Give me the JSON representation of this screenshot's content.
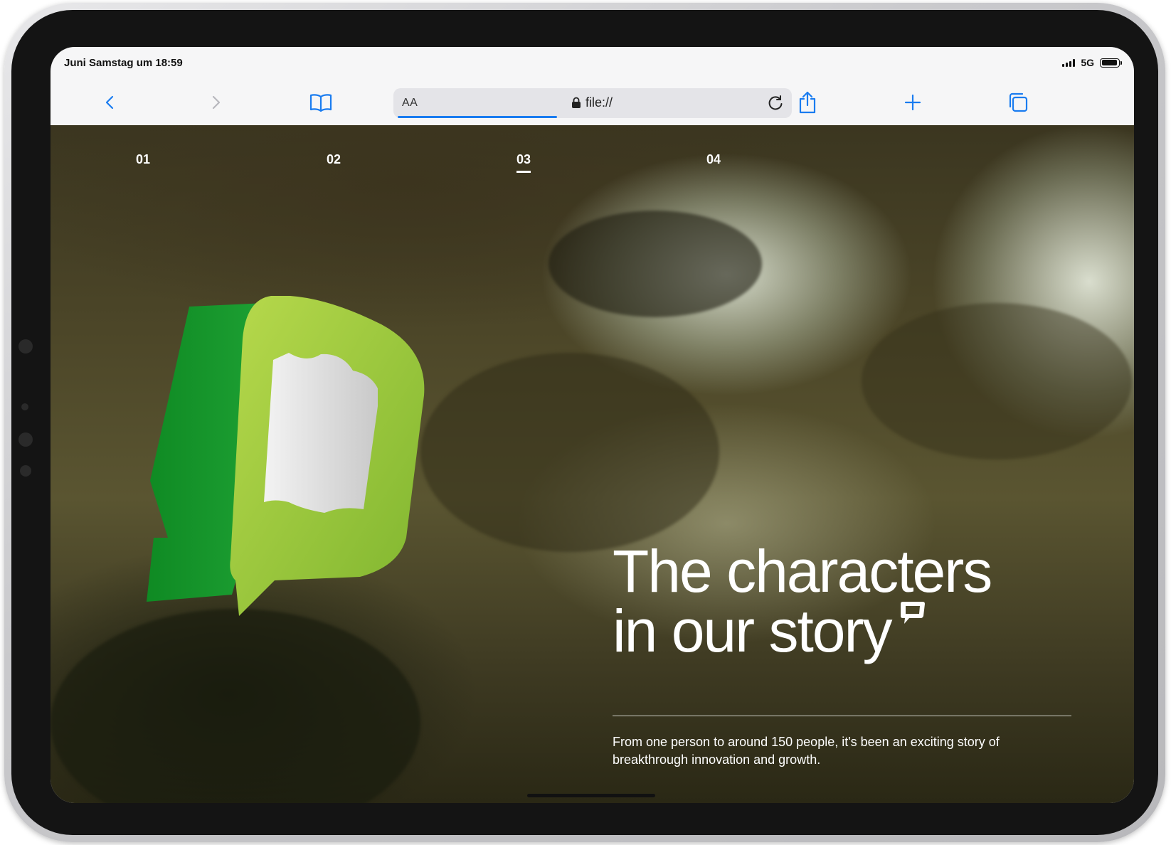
{
  "status_bar": {
    "time": "Juni Samstag um 18:59",
    "network": "5G",
    "battery_level": 0.95
  },
  "browser": {
    "text_size_label": "AA",
    "url": "file://",
    "load_progress": 0.4
  },
  "icons": {
    "back": "chevron-left-icon",
    "forward": "chevron-right-icon",
    "bookmarks": "book-icon",
    "lock": "lock-icon",
    "reload": "reload-icon",
    "share": "share-icon",
    "new_tab": "plus-icon",
    "tabs": "tabs-icon"
  },
  "page": {
    "nav": [
      {
        "label": "01",
        "active": false
      },
      {
        "label": "02",
        "active": false
      },
      {
        "label": "03",
        "active": true
      },
      {
        "label": "04",
        "active": false
      }
    ],
    "headline_line1": "The characters",
    "headline_line2": "in our story",
    "subtext": "From one person to around 150 people, it's been an exciting story of breakthrough innovation and growth."
  },
  "colors": {
    "accent": "#1a7cf0",
    "brand_green": "#1e9d2e",
    "brand_lime": "#8ec63f"
  }
}
